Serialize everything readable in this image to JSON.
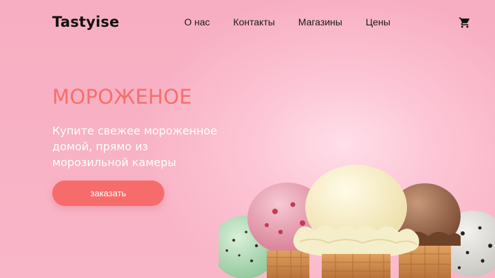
{
  "header": {
    "logo": "Tastyise",
    "nav": [
      "О нас",
      "Контакты",
      "Магазины",
      "Цены"
    ],
    "cart_icon": "shopping-cart-icon"
  },
  "hero": {
    "title": "МОРОЖЕНОЕ",
    "subtitle": "Купите свежее мороженное домой, прямо из морозильной камеры",
    "button_label": "заказать",
    "image": "ice-cream-scoops-image"
  },
  "colors": {
    "background": "#f9b3c6",
    "accent": "#f56f6b",
    "button": "#f66c6a",
    "text_dark": "#111111",
    "text_light": "#ffffff"
  }
}
